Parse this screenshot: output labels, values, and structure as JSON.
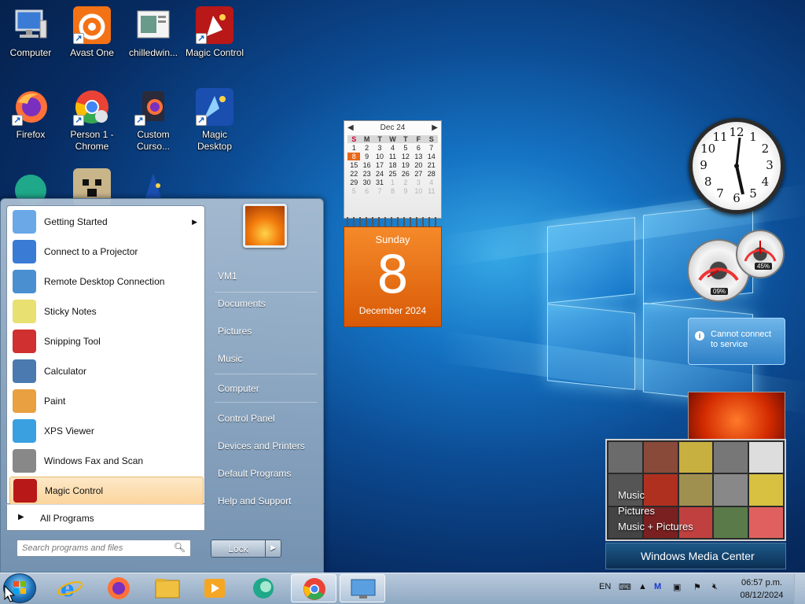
{
  "desktop": {
    "icons": [
      {
        "label": "Computer",
        "icon": "computer-icon"
      },
      {
        "label": "Avast One",
        "icon": "avast-icon"
      },
      {
        "label": "chilledwin...",
        "icon": "document-icon"
      },
      {
        "label": "Magic Control",
        "icon": "magic-control-icon"
      },
      {
        "label": "Firefox",
        "icon": "firefox-icon"
      },
      {
        "label": "Person 1 - Chrome",
        "icon": "chrome-icon"
      },
      {
        "label": "Custom Curso...",
        "icon": "custom-cursor-icon"
      },
      {
        "label": "Magic Desktop",
        "icon": "magic-desktop-icon"
      }
    ]
  },
  "calendar_gadget": {
    "month_label": "Dec 24",
    "day_headers": [
      "S",
      "M",
      "T",
      "W",
      "T",
      "F",
      "S"
    ],
    "weeks": [
      [
        "1",
        "2",
        "3",
        "4",
        "5",
        "6",
        "7"
      ],
      [
        "8",
        "9",
        "10",
        "11",
        "12",
        "13",
        "14"
      ],
      [
        "15",
        "16",
        "17",
        "18",
        "19",
        "20",
        "21"
      ],
      [
        "22",
        "23",
        "24",
        "25",
        "26",
        "27",
        "28"
      ],
      [
        "29",
        "30",
        "31",
        "1",
        "2",
        "3",
        "4"
      ],
      [
        "5",
        "6",
        "7",
        "8",
        "9",
        "10",
        "11"
      ]
    ],
    "weekday": "Sunday",
    "day": "8",
    "month_year": "December 2024"
  },
  "clock_gadget": {
    "numbers": [
      "12",
      "1",
      "2",
      "3",
      "4",
      "5",
      "6",
      "7",
      "8",
      "9",
      "10",
      "11"
    ]
  },
  "cpu_gadget": {
    "cpu_percent": "09%",
    "memory_percent": "45%"
  },
  "feed_gadget": {
    "message": "Cannot connect to service"
  },
  "media_center_gadget": {
    "items": [
      "Music",
      "Pictures",
      "Music + Pictures"
    ],
    "brand": "Windows Media Center"
  },
  "start_menu": {
    "programs": [
      {
        "label": "Getting Started",
        "icon": "getting-started-icon",
        "has_submenu": true
      },
      {
        "label": "Connect to a Projector",
        "icon": "projector-icon"
      },
      {
        "label": "Remote Desktop Connection",
        "icon": "remote-desktop-icon"
      },
      {
        "label": "Sticky Notes",
        "icon": "sticky-notes-icon"
      },
      {
        "label": "Snipping Tool",
        "icon": "snipping-tool-icon"
      },
      {
        "label": "Calculator",
        "icon": "calculator-icon"
      },
      {
        "label": "Paint",
        "icon": "paint-icon"
      },
      {
        "label": "XPS Viewer",
        "icon": "xps-viewer-icon"
      },
      {
        "label": "Windows Fax and Scan",
        "icon": "fax-scan-icon"
      },
      {
        "label": "Magic Control",
        "icon": "magic-control-icon",
        "highlighted": true
      }
    ],
    "all_programs": "All Programs",
    "search_placeholder": "Search programs and files",
    "right_items": [
      "VM1",
      "Documents",
      "Pictures",
      "Music",
      "Computer",
      "Control Panel",
      "Devices and Printers",
      "Default Programs",
      "Help and Support"
    ],
    "lock_label": "Lock"
  },
  "taskbar": {
    "pinned": [
      "internet-explorer-icon",
      "firefox-icon",
      "file-explorer-icon",
      "media-player-icon",
      "app-icon",
      "chrome-icon",
      "remote-desktop-icon"
    ],
    "tray": {
      "language": "EN",
      "time": "06:57 p.m.",
      "date": "08/12/2024"
    }
  },
  "colors": {
    "calendar_accent": "#e8681a",
    "start_highlight": "#fbd49c",
    "desktop_blue": "#0c4c94"
  }
}
